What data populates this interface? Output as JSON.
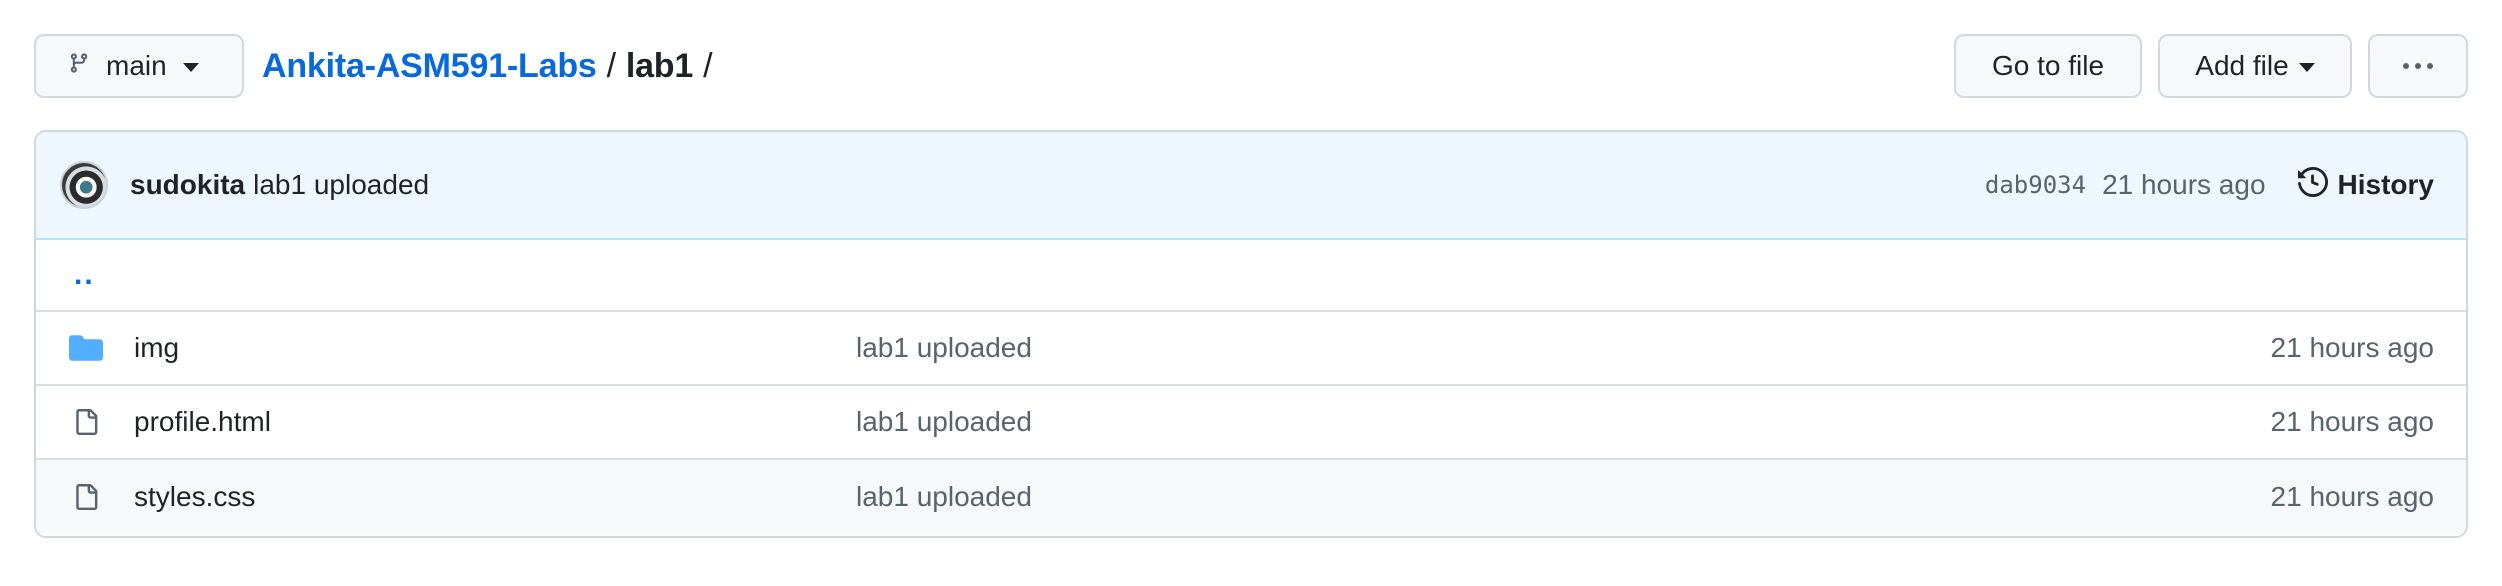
{
  "topbar": {
    "branch": {
      "label": "main",
      "icon": "git-branch-icon"
    },
    "breadcrumb": {
      "repo": "Ankita-ASM591-Labs",
      "separator": "/",
      "current": "lab1",
      "trailing": "/"
    },
    "go_to_file": "Go to file",
    "add_file": "Add file",
    "more_icon": "kebab-horizontal-icon"
  },
  "commit": {
    "author": "sudokita",
    "message": "lab1 uploaded",
    "sha": "dab9034",
    "time": "21 hours ago",
    "history_label": "History"
  },
  "parent_link": "..",
  "files": [
    {
      "type": "folder",
      "icon": "folder-icon",
      "name": "img",
      "message": "lab1 uploaded",
      "age": "21 hours ago"
    },
    {
      "type": "file",
      "icon": "file-icon",
      "name": "profile.html",
      "message": "lab1 uploaded",
      "age": "21 hours ago"
    },
    {
      "type": "file",
      "icon": "file-icon",
      "name": "styles.css",
      "message": "lab1 uploaded",
      "age": "21 hours ago"
    }
  ],
  "colors": {
    "link": "#0969da",
    "folder": "#54aeff",
    "commit_bar": "#eef6fe",
    "muted_text": "#59636e",
    "border": "#d1d9e0"
  }
}
